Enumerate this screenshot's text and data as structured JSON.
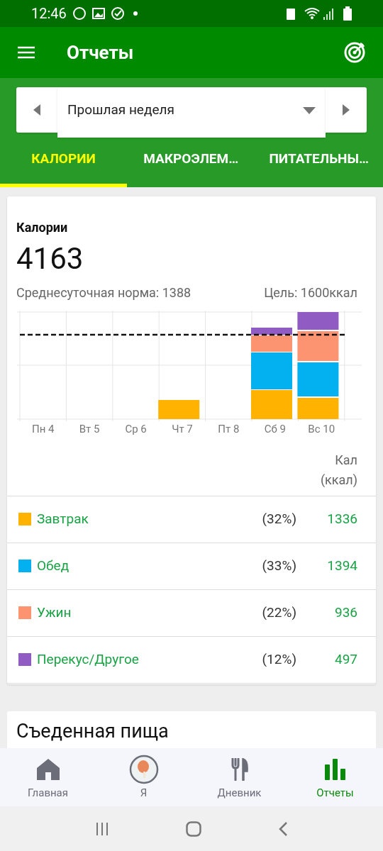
{
  "status_bar": {
    "time": "12:46"
  },
  "app_bar": {
    "title": "Отчеты"
  },
  "period": {
    "value": "Прошлая неделя"
  },
  "tabs": [
    {
      "label": "КАЛОРИИ",
      "selected": true
    },
    {
      "label": "МАКРОЭЛЕМ…",
      "selected": false
    },
    {
      "label": "ПИТАТЕЛЬНЫ…",
      "selected": false
    }
  ],
  "calories_card": {
    "title": "Калории",
    "total": "4163",
    "daily_average": "Среднесуточная норма: 1388",
    "goal": "Цель: 1600ккал",
    "chart_days": [
      "Пн 4",
      "Вт 5",
      "Ср 6",
      "Чт 7",
      "Пт 8",
      "Сб 9",
      "Вс 10"
    ],
    "column_header": [
      "Кал",
      "(ккал)"
    ],
    "meals": [
      {
        "name": "Завтрак",
        "color": "#ffb300",
        "percent": "(32%)",
        "calories": "1336"
      },
      {
        "name": "Обед",
        "color": "#03b0f0",
        "percent": "(33%)",
        "calories": "1394"
      },
      {
        "name": "Ужин",
        "color": "#fc9472",
        "percent": "(22%)",
        "calories": "936"
      },
      {
        "name": "Перекус/Другое",
        "color": "#905cc4",
        "percent": "(12%)",
        "calories": "497"
      }
    ]
  },
  "eaten_card": {
    "title": "Съеденная пища"
  },
  "bottom_nav": [
    {
      "label": "Главная",
      "kind": "home",
      "selected": false
    },
    {
      "label": "Я",
      "kind": "avatar",
      "selected": false
    },
    {
      "label": "Дневник",
      "kind": "diary",
      "selected": false
    },
    {
      "label": "Отчеты",
      "kind": "reports",
      "selected": true
    }
  ]
}
